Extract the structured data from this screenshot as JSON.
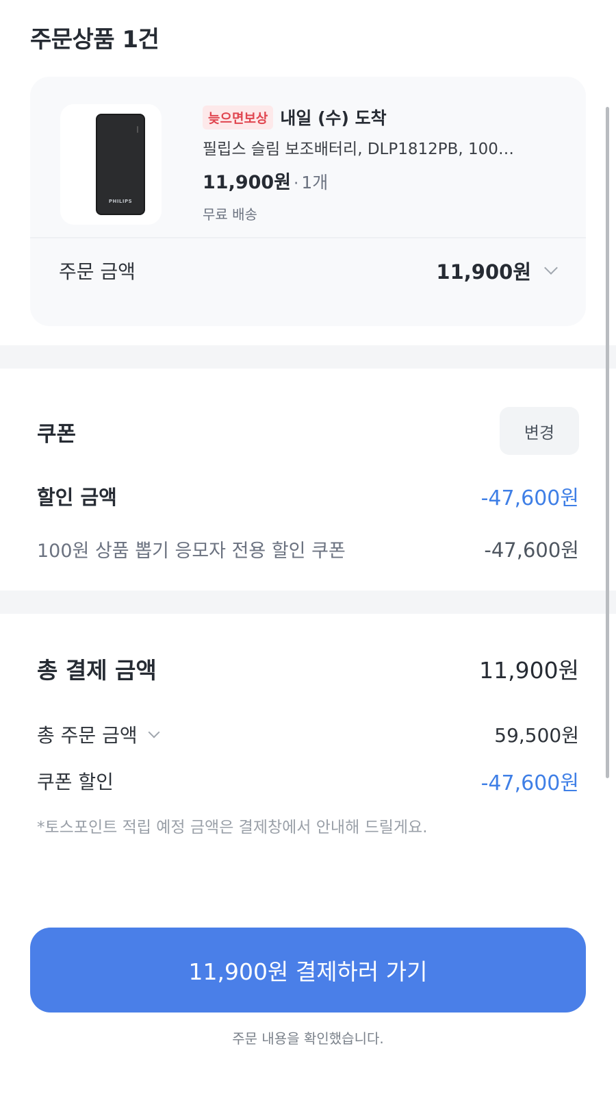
{
  "header": {
    "title": "주문상품 1건"
  },
  "product": {
    "badge": "늦으면보상",
    "delivery": "내일 (수) 도착",
    "name": "필립스 슬림 보조배터리, DLP1812PB, 100…",
    "price": "11,900원",
    "dot": "·",
    "quantity": "1개",
    "shipping": "무료 배송",
    "image_brand": "PHILIPS"
  },
  "order_amount": {
    "label": "주문 금액",
    "value": "11,900원"
  },
  "coupon": {
    "title": "쿠폰",
    "change_label": "변경",
    "discount_label": "할인 금액",
    "discount_value": "-47,600원",
    "item_label": "100원 상품 뽑기 응모자 전용 할인 쿠폰",
    "item_value": "-47,600원"
  },
  "payment": {
    "total_label": "총 결제 금액",
    "total_value": "11,900원",
    "order_total_label": "총 주문 금액",
    "order_total_value": "59,500원",
    "coupon_discount_label": "쿠폰 할인",
    "coupon_discount_value": "-47,600원",
    "note": "*토스포인트 적립 예정 금액은 결제창에서 안내해 드릴게요."
  },
  "footer": {
    "pay_button_label": "11,900원 결제하러 가기",
    "confirm_text": "주문 내용을 확인했습니다."
  },
  "colors": {
    "accent_blue": "#4a7fe8",
    "discount_blue": "#3f7fe6",
    "badge_red": "#e0454f"
  }
}
